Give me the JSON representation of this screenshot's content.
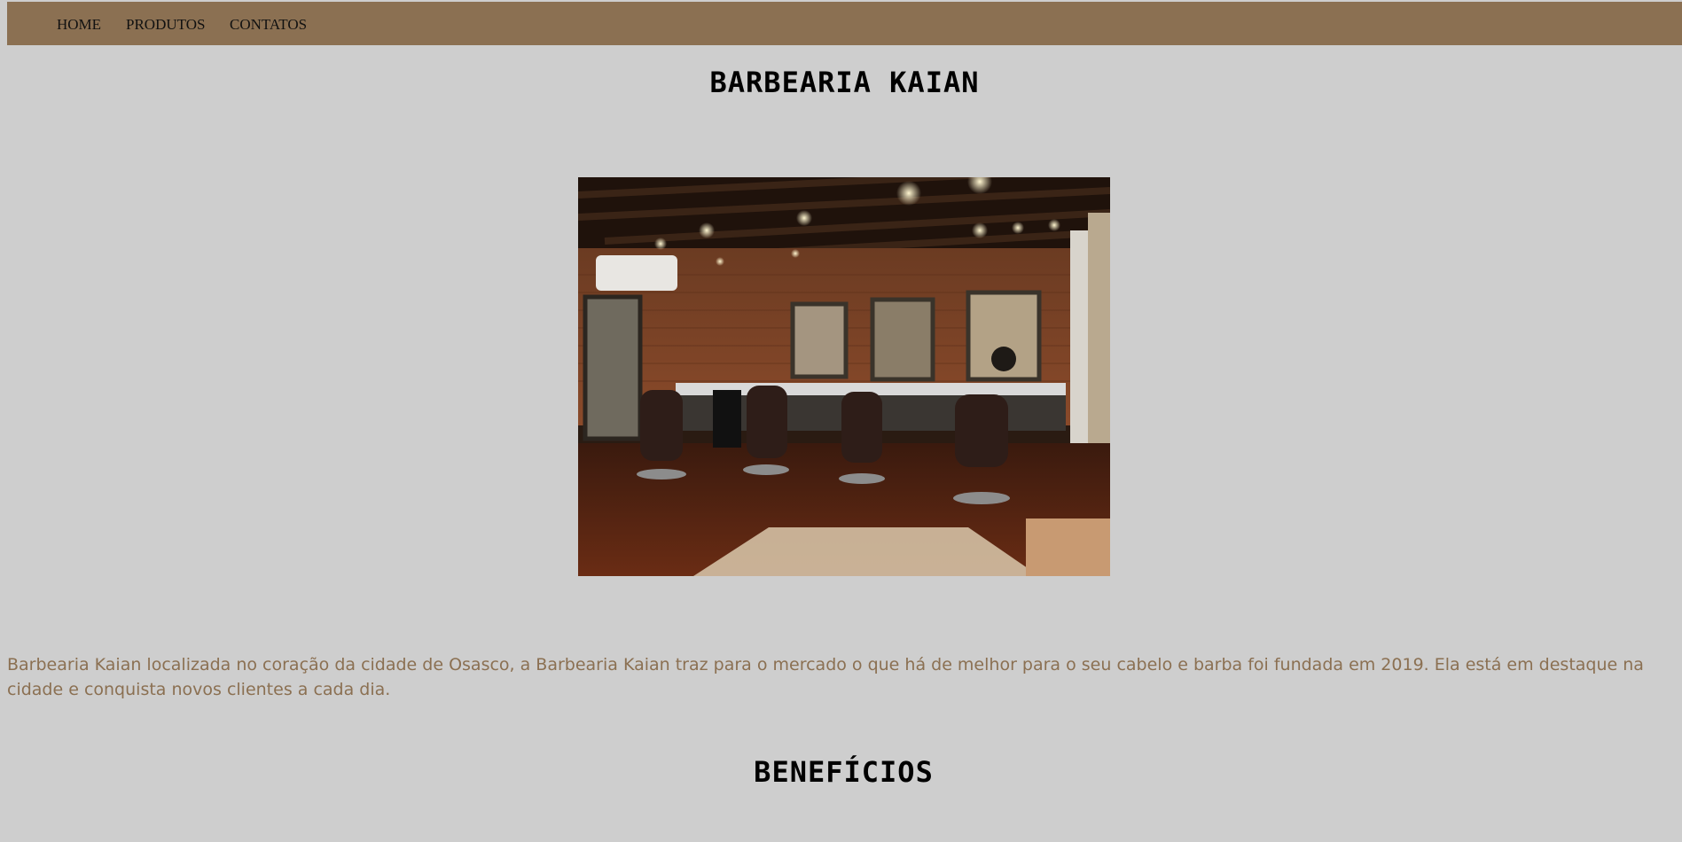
{
  "nav": {
    "items": [
      {
        "label": "HOME"
      },
      {
        "label": "PRODUTOS"
      },
      {
        "label": "CONTATOS"
      }
    ],
    "background": "#8b7052"
  },
  "header": {
    "title": "BARBEARIA KAIAN"
  },
  "hero_image": {
    "icon": "barbershop-interior-photo"
  },
  "about": {
    "text": "Barbearia Kaian localizada no coração da cidade de Osasco, a Barbearia Kaian traz para o mercado o que há de melhor para o seu cabelo e barba foi fundada em 2019. Ela está em destaque na cidade e conquista novos clientes a cada dia.",
    "color": "#8b7052"
  },
  "benefits": {
    "title": "BENEFÍCIOS"
  },
  "page": {
    "background": "#cecece"
  }
}
